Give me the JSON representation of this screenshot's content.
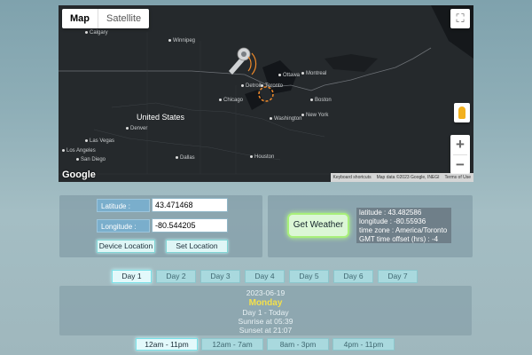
{
  "map": {
    "type_map": "Map",
    "type_satellite": "Satellite",
    "zoom_in": "+",
    "zoom_out": "−",
    "google": "Google",
    "attrib": {
      "shortcuts": "Keyboard shortcuts",
      "data": "Map data ©2023 Google, INEGI",
      "terms": "Terms of Use"
    },
    "cities": {
      "calgary": "Calgary",
      "winnipeg": "Winnipeg",
      "ottawa": "Ottawa",
      "montreal": "Montreal",
      "toronto": "Toronto",
      "chicago": "Chicago",
      "boston": "Boston",
      "new_york": "New York",
      "washington": "Washington",
      "united_states": "United States",
      "las_vegas": "Las Vegas",
      "los_angeles": "Los Angeles",
      "san_diego": "San Diego",
      "dallas": "Dallas",
      "houston": "Houston",
      "denver": "Denver",
      "detroit": "Detroit"
    }
  },
  "coords": {
    "latitude_label": "Latitude :",
    "latitude_value": "43.471468",
    "longitude_label": "Longitude :",
    "longitude_value": "-80.544205",
    "device_btn": "Device Location",
    "set_btn": "Set Location"
  },
  "weather": {
    "button": "Get Weather",
    "info": {
      "latitude": "latitude : 43.482586",
      "longitude": "longitude : -80.55936",
      "timezone": "time zone : America/Toronto",
      "offset": "GMT time offset (hrs) : -4"
    }
  },
  "days": [
    "Day 1",
    "Day 2",
    "Day 3",
    "Day 4",
    "Day 5",
    "Day 6",
    "Day 7"
  ],
  "day_detail": {
    "date": "2023-06-19",
    "weekday": "Monday",
    "label": "Day 1 - Today",
    "sunrise": "Sunrise at 05:39",
    "sunset": "Sunset at 21:07"
  },
  "time_ranges": [
    "12am - 11pm",
    "12am - 7am",
    "8am - 3pm",
    "4pm - 11pm"
  ],
  "colors": {
    "accent_yellow": "#f3e04c",
    "weather_button": "#a8f07a",
    "label_blue": "#7aaecc"
  }
}
